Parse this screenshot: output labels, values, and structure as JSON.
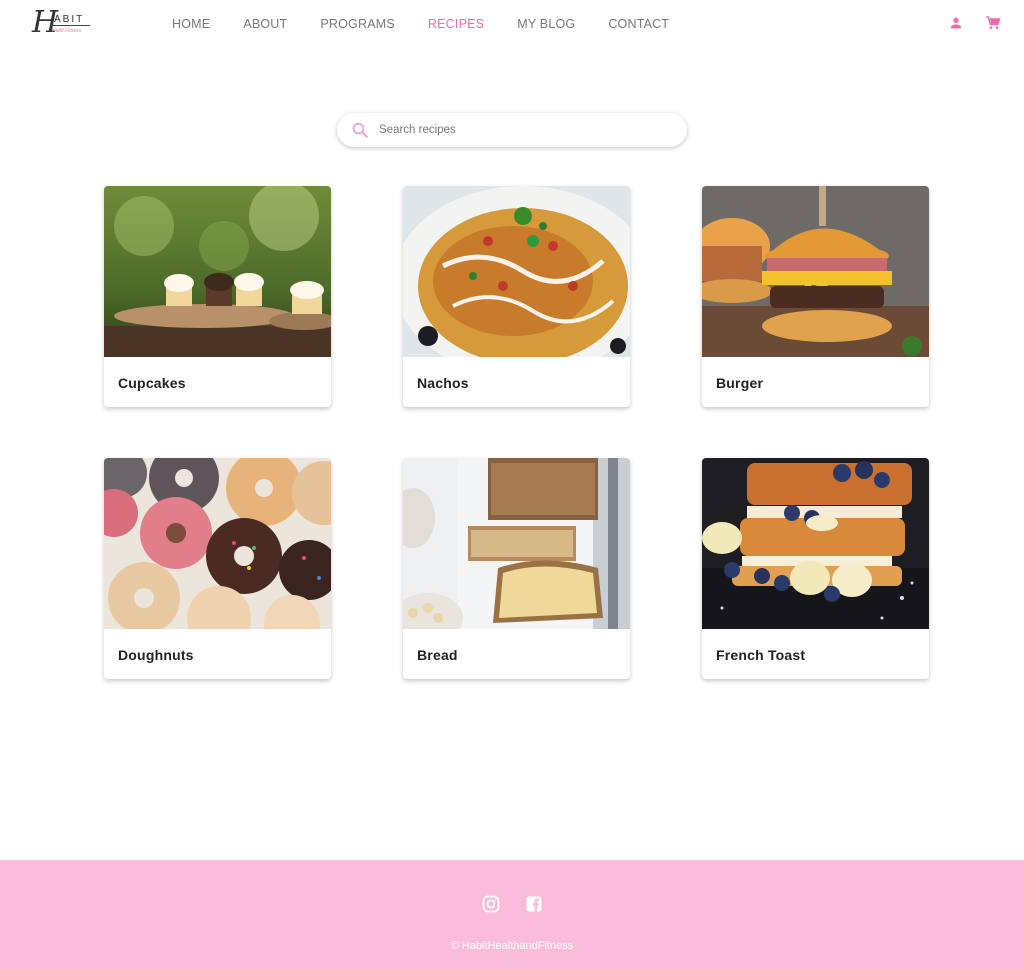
{
  "brand": {
    "logo_letters": "ABIT",
    "logo_initial": "H",
    "logo_tagline": "Habit Fitness"
  },
  "nav": {
    "items": [
      {
        "label": "HOME"
      },
      {
        "label": "ABOUT"
      },
      {
        "label": "PROGRAMS"
      },
      {
        "label": "RECIPES",
        "active": true
      },
      {
        "label": "MY BLOG"
      },
      {
        "label": "CONTACT"
      }
    ],
    "active_color": "#f06aa9",
    "icons": [
      "user-icon",
      "cart-icon"
    ]
  },
  "search": {
    "placeholder": "Search recipes",
    "value": "",
    "icon": "search-icon"
  },
  "recipes": [
    {
      "title": "Cupcakes"
    },
    {
      "title": "Nachos"
    },
    {
      "title": "Burger"
    },
    {
      "title": "Doughnuts"
    },
    {
      "title": "Bread"
    },
    {
      "title": "French Toast"
    }
  ],
  "footer": {
    "social": [
      "instagram-icon",
      "facebook-icon"
    ],
    "copyright": "© HabitHealthandFitness",
    "background": "#fbbcdb"
  },
  "colors": {
    "accent": "#f06aa9",
    "footer_bg": "#fbbcdb"
  }
}
